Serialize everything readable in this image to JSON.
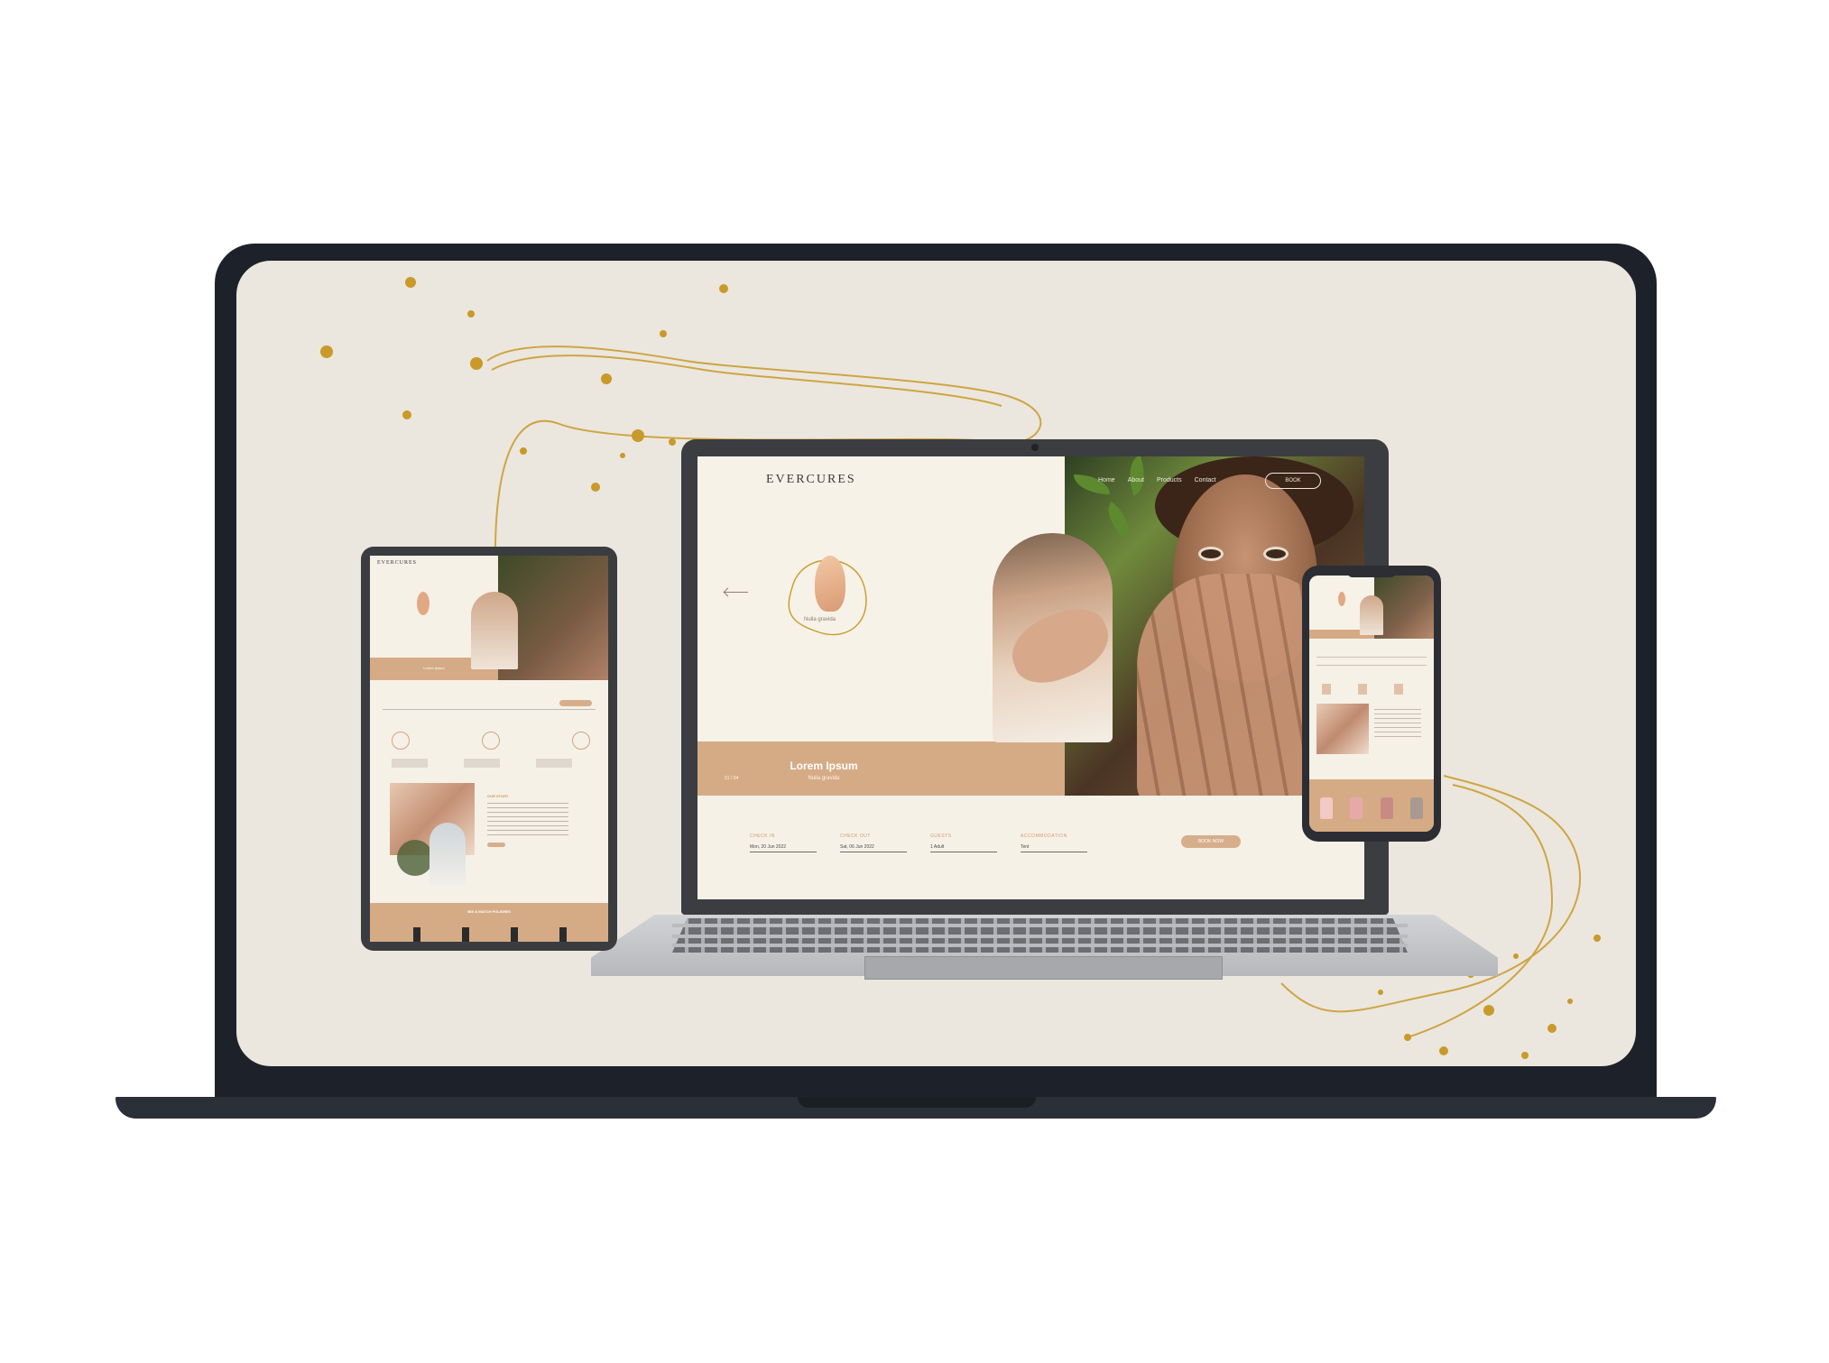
{
  "site": {
    "logo": "EVERCURES",
    "nav": [
      "Home",
      "About",
      "Products",
      "Contact"
    ],
    "book_button": "BOOK",
    "hero": {
      "nail_caption": "Nulla gravida",
      "title": "Lorem Ipsum",
      "subtitle": "Nulla gravida",
      "counter": "01 / 04"
    },
    "booking_form": {
      "check_in_label": "CHECK IN",
      "check_in_value": "Mon, 20 Jun 2022",
      "check_out_label": "CHECK OUT",
      "check_out_value": "Sat, 06 Jun 2022",
      "guests_label": "GUESTS",
      "guests_value": "1 Adult",
      "accommodation_label": "ACCOMMODATION",
      "accommodation_value": "Tent",
      "submit_label": "BOOK NOW"
    }
  },
  "tablet": {
    "logo": "EVERCURES",
    "band_title": "Lorem Ipsum",
    "story_title": "OUR STORY",
    "footer_title": "MIX & MATCH POLISHES"
  },
  "phone": {
    "bottle_colors": [
      "#f2c9c4",
      "#e8a8a8",
      "#c98a86",
      "#a89a92"
    ]
  },
  "colors": {
    "accent": "#d5ab86",
    "background": "#ebe7de",
    "device_dark": "#1d222a",
    "gold": "#c99a2a"
  }
}
